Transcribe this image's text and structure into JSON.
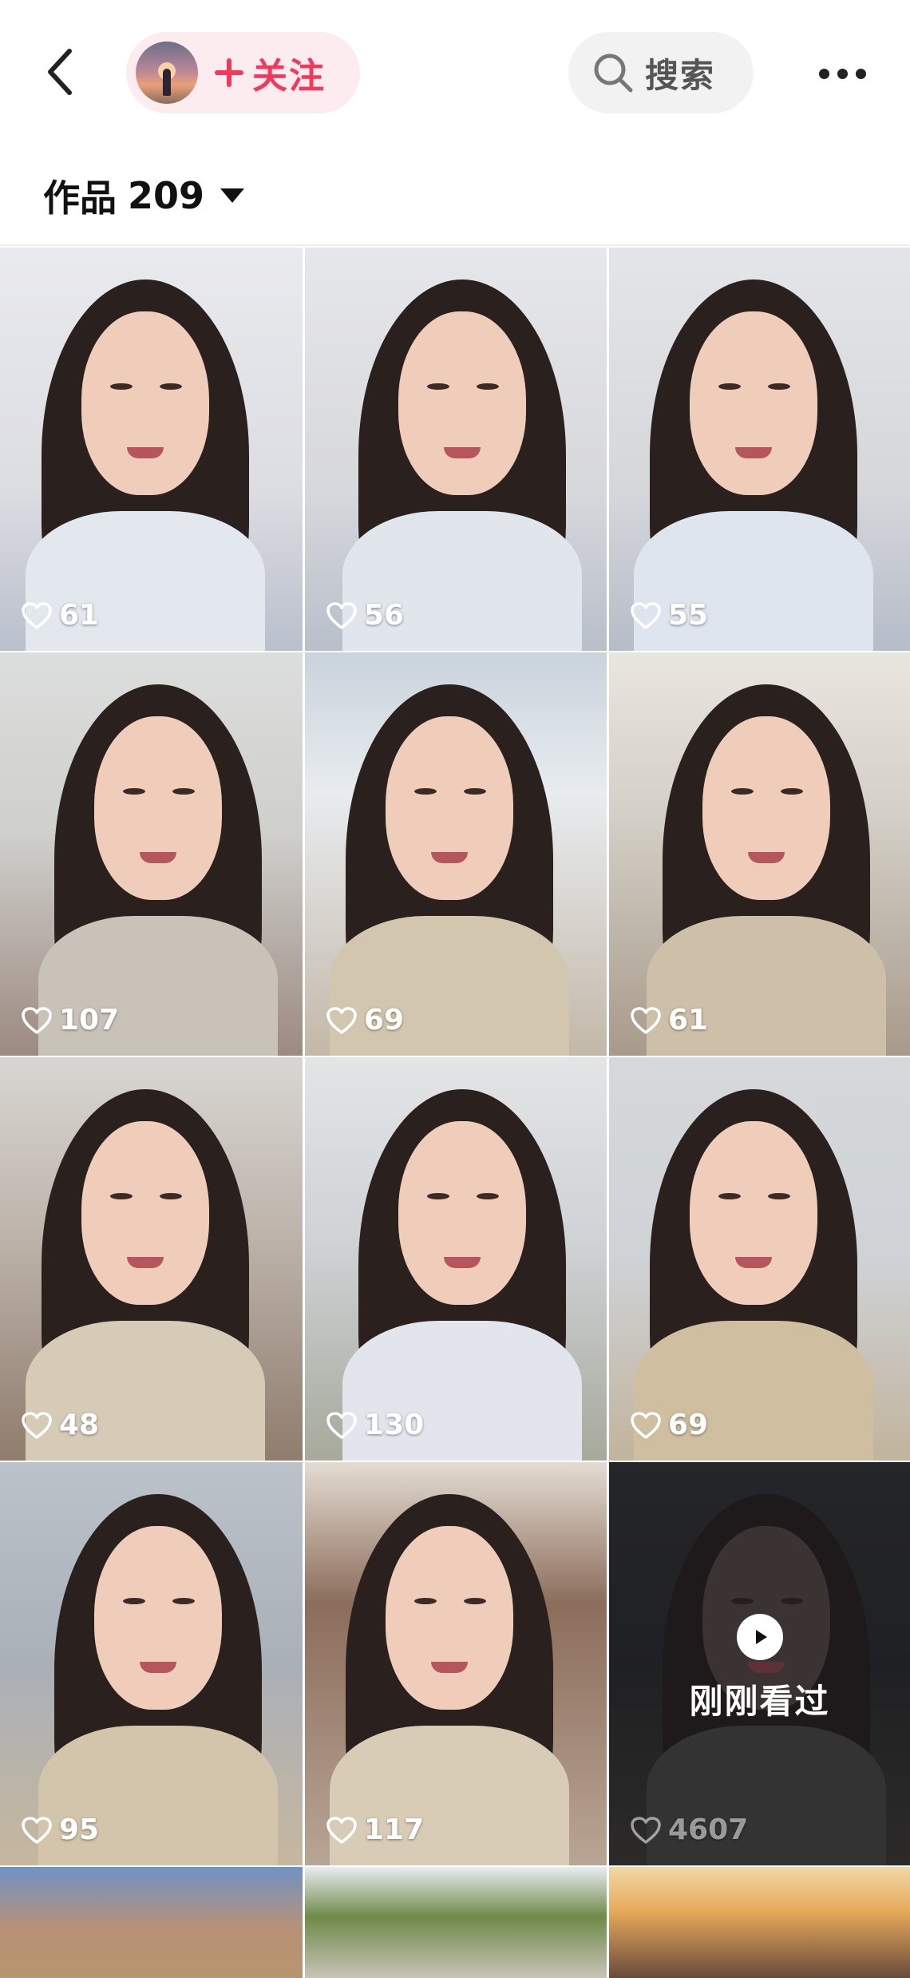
{
  "header": {
    "follow_label": "关注",
    "search_label": "搜索"
  },
  "works": {
    "label": "作品",
    "count": "209"
  },
  "colors": {
    "accent": "#f2385b",
    "follow_bg": "#fdecef",
    "search_bg": "#f2f2f2"
  },
  "icons": {
    "back": "chevron-left-icon",
    "plus": "plus-icon",
    "search": "search-icon",
    "more": "more-dots-icon",
    "caret": "caret-down-icon",
    "heart": "heart-outline-icon",
    "play": "play-icon"
  },
  "videos": [
    {
      "likes": "61"
    },
    {
      "likes": "56"
    },
    {
      "likes": "55"
    },
    {
      "likes": "107"
    },
    {
      "likes": "69"
    },
    {
      "likes": "61"
    },
    {
      "likes": "48"
    },
    {
      "likes": "130"
    },
    {
      "likes": "69"
    },
    {
      "likes": "95"
    },
    {
      "likes": "117"
    },
    {
      "likes": "4607",
      "recent_label": "刚刚看过"
    },
    {
      "likes": ""
    },
    {
      "likes": ""
    },
    {
      "likes": ""
    }
  ]
}
